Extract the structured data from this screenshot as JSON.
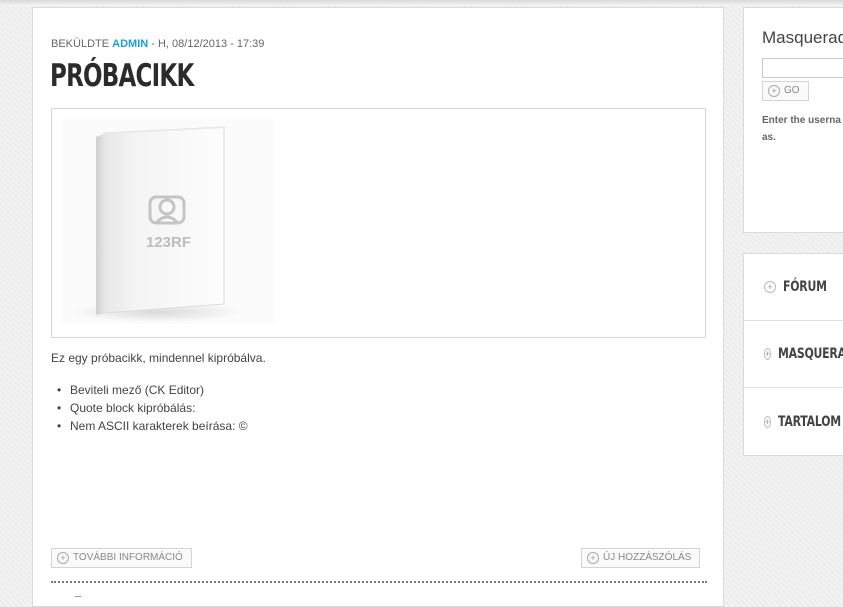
{
  "article": {
    "meta_prefix": "BEKÜLDTE",
    "author": "ADMIN",
    "meta_date": "- H, 08/12/2013 - 17:39",
    "title": "PRÓBACIKK",
    "image": {
      "watermark": "123RF"
    },
    "body": "Ez egy próbacikk, mindennel kipróbálva.",
    "bullets": [
      "Beviteli mező (CK Editor)",
      "Quote block kipróbálás:",
      "Nem ASCII karakterek beírása: ©"
    ],
    "links": {
      "more": "TOVÁBBI INFORMÁCIÓ",
      "comment": "ÚJ HOZZÁSZÓLÁS"
    }
  },
  "sidebar": {
    "masquerade": {
      "title": "Masquerad",
      "input_value": "",
      "go_label": "GO",
      "help_lines": [
        "Enter the userna",
        "as."
      ]
    },
    "menu": [
      "FÓRUM",
      "MASQUERA",
      "TARTALOM"
    ]
  },
  "icons": {
    "expand": "plus-circle-icon"
  }
}
